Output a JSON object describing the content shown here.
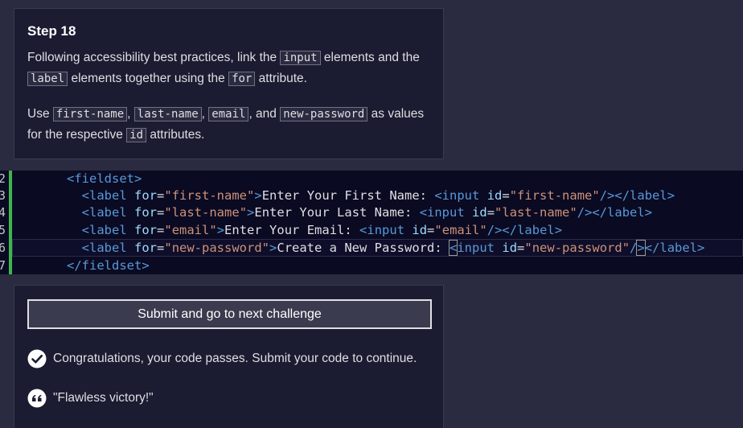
{
  "description": {
    "step_title": "Step 18",
    "para1": {
      "t1": "Following accessibility best practices, link the ",
      "c1": "input",
      "t2": " elements and the ",
      "c2": "label",
      "t3": " elements together using the ",
      "c3": "for",
      "t4": " attribute."
    },
    "para2": {
      "t1": "Use ",
      "c1": "first-name",
      "t2": ", ",
      "c2": "last-name",
      "t3": ", ",
      "c3": "email",
      "t4": ", and ",
      "c4": "new-password",
      "t5": " as values for the respective ",
      "c5": "id",
      "t6": " attributes."
    }
  },
  "editor": {
    "line_numbers": [
      "2",
      "3",
      "4",
      "5",
      "6",
      "7"
    ],
    "lines": [
      {
        "indent": "      ",
        "open": "<fieldset>"
      },
      {
        "indent": "        ",
        "for": "first-name",
        "text": "Enter Your First Name: ",
        "id": "first-name"
      },
      {
        "indent": "        ",
        "for": "last-name",
        "text": "Enter Your Last Name: ",
        "id": "last-name"
      },
      {
        "indent": "        ",
        "for": "email",
        "text": "Enter Your Email: ",
        "id": "email"
      },
      {
        "indent": "        ",
        "for": "new-password",
        "text": "Create a New Password: ",
        "id": "new-password"
      },
      {
        "indent": "      ",
        "close": "</fieldset>"
      }
    ]
  },
  "result": {
    "submit_label": "Submit and go to next challenge",
    "pass_message": "Congratulations, your code passes. Submit your code to continue.",
    "quote": "\"Flawless victory!\""
  }
}
